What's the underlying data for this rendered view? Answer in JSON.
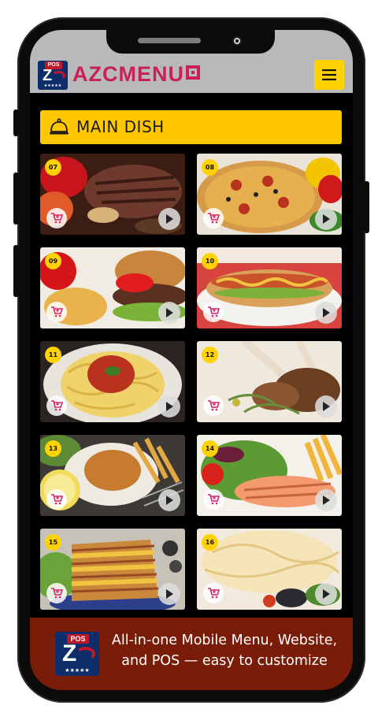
{
  "header": {
    "badge_text": "POS",
    "badge_stars": "★★★★★",
    "brand_prefix": "AZC",
    "brand_suffix": "MENU"
  },
  "section": {
    "title": "MAIN DISH"
  },
  "items": [
    {
      "number": "07"
    },
    {
      "number": "08"
    },
    {
      "number": "09"
    },
    {
      "number": "10"
    },
    {
      "number": "11"
    },
    {
      "number": "12"
    },
    {
      "number": "13"
    },
    {
      "number": "14"
    },
    {
      "number": "15"
    },
    {
      "number": "16"
    }
  ],
  "footer": {
    "badge_text": "POS",
    "badge_stars": "★★★★★",
    "line1": "All-in-one Mobile Menu, Website,",
    "line2": "and POS — easy to customize"
  },
  "colors": {
    "accent_yellow": "#ffc700",
    "brand_pink": "#c8215a",
    "footer_brown": "#7a1d08",
    "header_gray": "#b9b9bb"
  },
  "icons": [
    "hamburger-icon",
    "bell-icon",
    "cart-icon",
    "play-icon"
  ]
}
